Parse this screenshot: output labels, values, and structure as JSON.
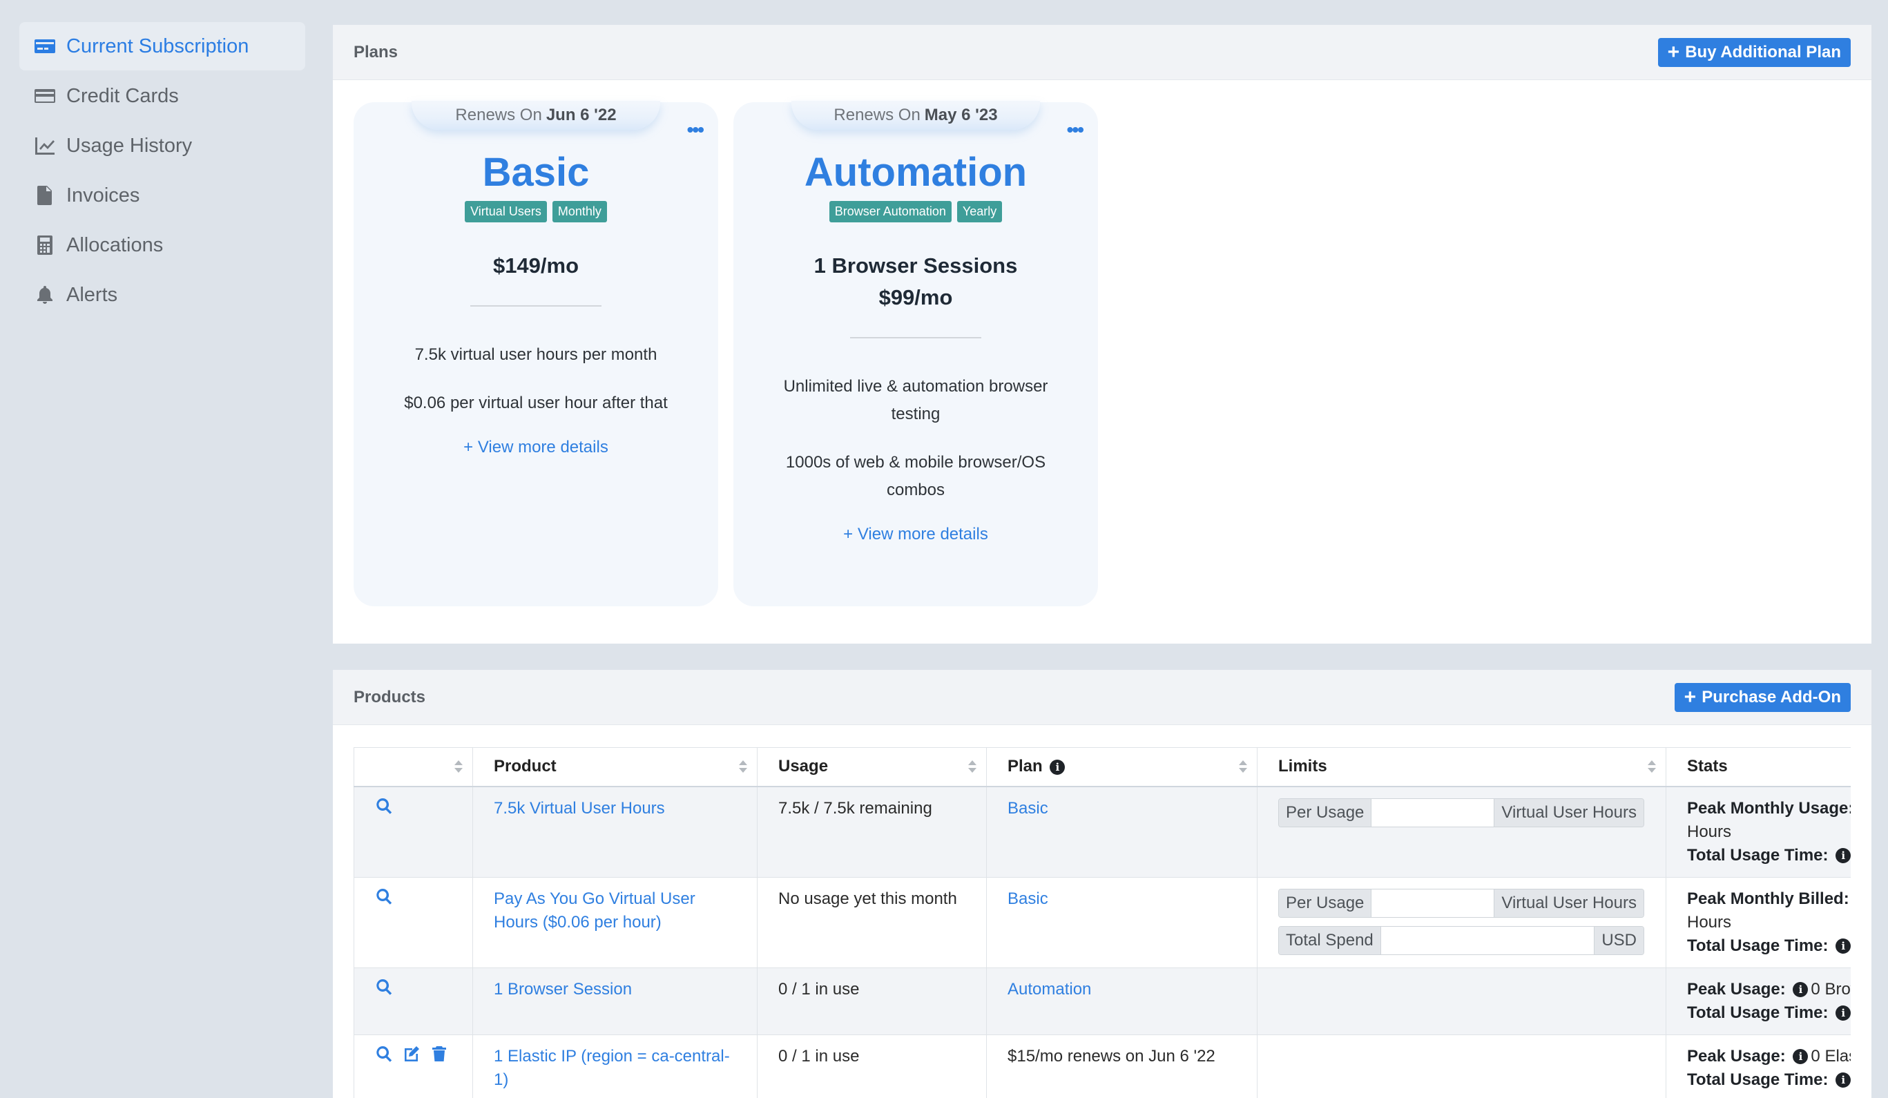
{
  "sidebar": {
    "items": [
      {
        "label": "Current Subscription",
        "icon": "credit-card-front-icon",
        "active": true
      },
      {
        "label": "Credit Cards",
        "icon": "credit-card-icon",
        "active": false
      },
      {
        "label": "Usage History",
        "icon": "chart-line-icon",
        "active": false
      },
      {
        "label": "Invoices",
        "icon": "file-icon",
        "active": false
      },
      {
        "label": "Allocations",
        "icon": "calculator-icon",
        "active": false
      },
      {
        "label": "Alerts",
        "icon": "bell-icon",
        "active": false
      }
    ]
  },
  "plans": {
    "title": "Plans",
    "buy_button": "Buy Additional Plan",
    "cards": [
      {
        "renews_prefix": "Renews On",
        "renews_date": "Jun 6 '22",
        "name": "Basic",
        "badges": [
          "Virtual Users",
          "Monthly"
        ],
        "price_line1": "$149/mo",
        "price_line2": "",
        "features": [
          "7.5k virtual user hours per month",
          "$0.06 per virtual user hour after that"
        ],
        "more_link": "+ View more details"
      },
      {
        "renews_prefix": "Renews On",
        "renews_date": "May 6 '23",
        "name": "Automation",
        "badges": [
          "Browser Automation",
          "Yearly"
        ],
        "price_line1": "1 Browser Sessions",
        "price_line2": "$99/mo",
        "features": [
          "Unlimited live & automation browser testing",
          "1000s of web & mobile browser/OS combos"
        ],
        "more_link": "+ View more details"
      }
    ]
  },
  "products": {
    "title": "Products",
    "purchase_button": "Purchase Add-On",
    "columns": [
      "",
      "Product",
      "Usage",
      "Plan",
      "Limits",
      "Stats"
    ],
    "rows": [
      {
        "product": "7.5k Virtual User Hours",
        "usage": "7.5k / 7.5k remaining",
        "plan": "Basic",
        "limits": [
          {
            "label": "Per Usage",
            "value": "",
            "unit": "Virtual User Hours"
          }
        ],
        "stats": [
          {
            "label": "Peak Monthly Usage:",
            "value": ""
          },
          {
            "label": "",
            "value": "Hours"
          },
          {
            "label": "Total Usage Time:",
            "value": ""
          }
        ]
      },
      {
        "product": "Pay As You Go Virtual User Hours ($0.06 per hour)",
        "usage": "No usage yet this month",
        "plan": "Basic",
        "limits": [
          {
            "label": "Per Usage",
            "value": "",
            "unit": "Virtual User Hours"
          },
          {
            "label": "Total Spend",
            "value": "",
            "unit": "USD"
          }
        ],
        "stats": [
          {
            "label": "Peak Monthly Billed:",
            "value": ""
          },
          {
            "label": "",
            "value": "Hours"
          },
          {
            "label": "Total Usage Time:",
            "value": ""
          }
        ]
      },
      {
        "product": "1 Browser Session",
        "usage": "0 / 1 in use",
        "plan": "Automation",
        "limits": [],
        "stats": [
          {
            "label": "Peak Usage:",
            "value": "0 Brow"
          },
          {
            "label": "Total Usage Time:",
            "value": ""
          }
        ]
      },
      {
        "product": "1 Elastic IP (region = ca-central-1)",
        "usage": "0 / 1 in use",
        "plan": "$15/mo renews on Jun 6 '22",
        "limits": [],
        "stats": [
          {
            "label": "Peak Usage:",
            "value": "0 Elas"
          },
          {
            "label": "Total Usage Time:",
            "value": ""
          }
        ]
      }
    ]
  }
}
